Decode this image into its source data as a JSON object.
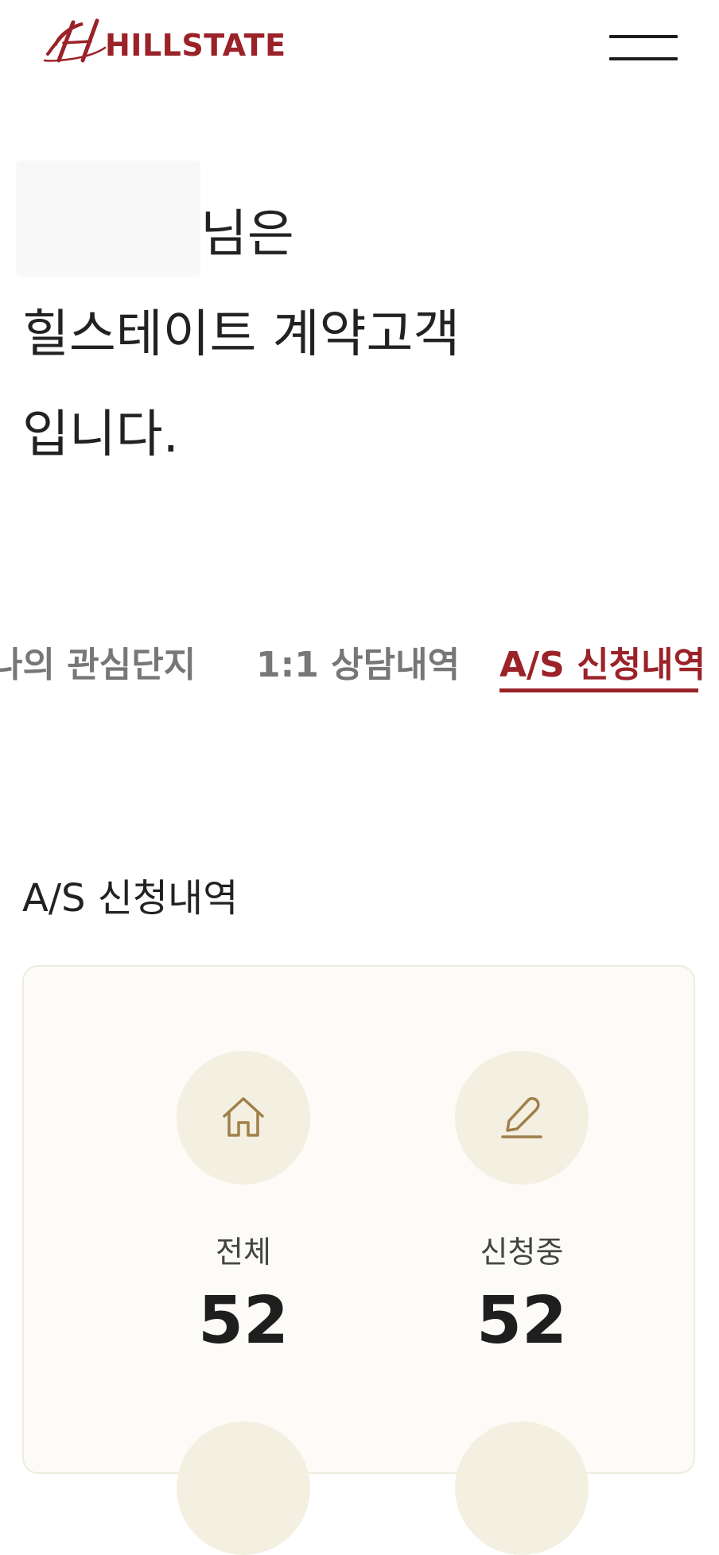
{
  "header": {
    "logo_text": "HILLSTATE",
    "logo_mark": "H",
    "brand_color": "#9a2228",
    "menu_icon": "hamburger-menu-icon"
  },
  "greeting": {
    "line1_suffix": "님은",
    "line2": "힐스테이트 계약고객",
    "line3": "입니다."
  },
  "tabs": [
    {
      "label": "나의 관심단지",
      "active": false
    },
    {
      "label": "1:1 상담내역",
      "active": false
    },
    {
      "label": "A/S 신청내역",
      "active": true
    }
  ],
  "section": {
    "title": "A/S 신청내역"
  },
  "summary": {
    "items": [
      {
        "icon": "house-icon",
        "label": "전체",
        "value": "52"
      },
      {
        "icon": "pencil-icon",
        "label": "신청중",
        "value": "52"
      }
    ]
  },
  "colors": {
    "accent": "#9a2228",
    "card_bg": "#fcfbf7",
    "icon_circle": "#f3efe1",
    "icon_stroke": "#a0804a"
  }
}
